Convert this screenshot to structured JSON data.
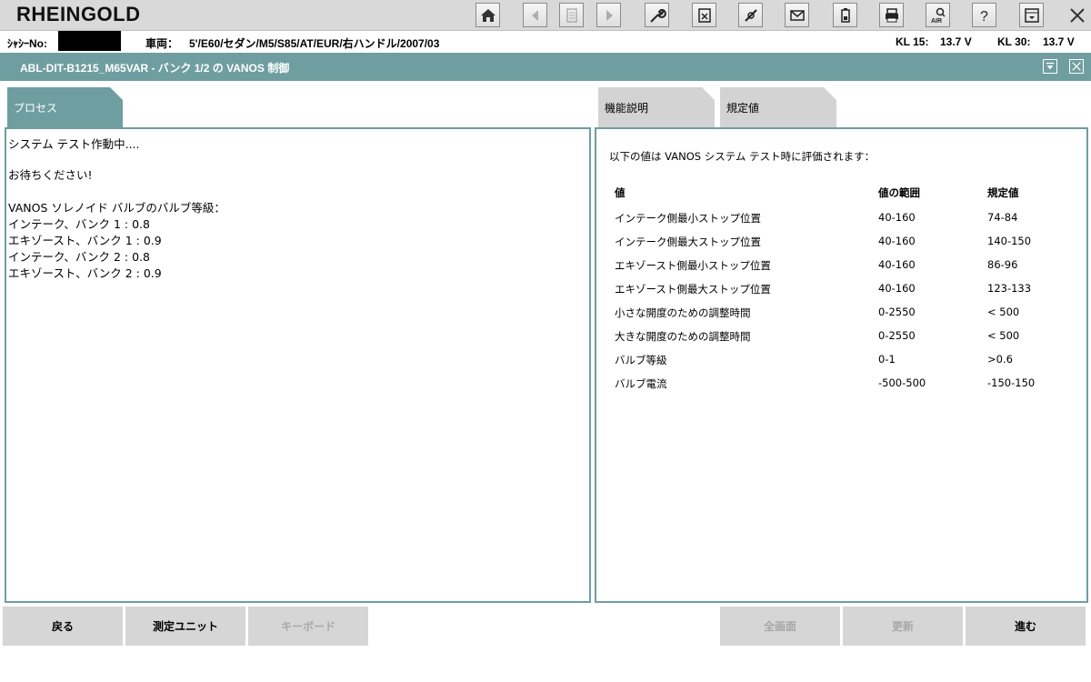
{
  "app": {
    "title": "RHEINGOLD"
  },
  "toolbar": {
    "icons": [
      "home-icon",
      "back-arrow-icon",
      "document-icon",
      "forward-arrow-icon",
      "wrench-icon",
      "fault-memory-icon",
      "measure-icon",
      "message-icon",
      "battery-icon",
      "print-icon",
      "air-search-icon",
      "help-icon",
      "settings-dropdown-icon",
      "close-icon"
    ]
  },
  "vehicle": {
    "vin_label": "ｼｬｼｰNo:",
    "vehicle_label": "車両：",
    "vehicle_value": "5'/E60/セダン/M5/S85/AT/EUR/右ハンドル/2007/03",
    "kl15_label": "KL 15:",
    "kl15_value": "13.7 V",
    "kl30_label": "KL 30:",
    "kl30_value": "13.7 V"
  },
  "window": {
    "title": "ABL-DIT-B1215_M65VAR - バンク 1/2 の VANOS 制御"
  },
  "tabs": {
    "process": "プロセス",
    "function": "機能説明",
    "spec": "規定値"
  },
  "log": {
    "lines": [
      "システム テスト作動中....",
      "",
      "お待ちください!",
      "",
      "VANOS ソレノイド バルブのバルブ等級：",
      "インテーク、バンク 1 : 0.8",
      "エキゾースト、バンク 1 : 0.9",
      "インテーク、バンク 2 : 0.8",
      "エキゾースト、バンク 2 : 0.9"
    ]
  },
  "spec": {
    "intro": "以下の値は VANOS システム テスト時に評価されます：",
    "headers": [
      "値",
      "値の範囲",
      "規定値"
    ],
    "rows": [
      [
        "インテーク側最小ストップ位置",
        "40-160",
        "74-84"
      ],
      [
        "インテーク側最大ストップ位置",
        "40-160",
        "140-150"
      ],
      [
        "エキゾースト側最小ストップ位置",
        "40-160",
        "86-96"
      ],
      [
        "エキゾースト側最大ストップ位置",
        "40-160",
        "123-133"
      ],
      [
        "小さな開度のための調整時間",
        "0-2550",
        "< 500"
      ],
      [
        "大きな開度のための調整時間",
        "0-2550",
        "< 500"
      ],
      [
        "バルブ等級",
        "0-1",
        ">0.6"
      ],
      [
        "バルブ電流",
        "-500-500",
        "-150-150"
      ]
    ]
  },
  "buttons": {
    "back": "戻る",
    "measure": "測定ユニット",
    "keyboard": "キーボード",
    "fullscreen": "全画面",
    "update": "更新",
    "next": "進む"
  },
  "colors": {
    "accent": "#6f9ea0",
    "toolbar": "#d9d9d9",
    "button": "#d6d6d6"
  }
}
